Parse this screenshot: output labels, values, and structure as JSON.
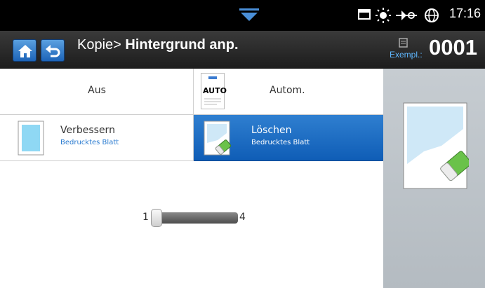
{
  "status_bar": {
    "time": "17:16",
    "icons": [
      "pull-down-arrow-icon",
      "window-icon",
      "brightness-icon",
      "network-icon",
      "globe-icon"
    ]
  },
  "header": {
    "title_prefix": "Kopie> ",
    "title_main": "Hintergrund anp.",
    "copies_label": "Exempl.:",
    "copies_value": "0001",
    "buttons": [
      "home-icon",
      "back-icon"
    ]
  },
  "options": [
    {
      "label": "Aus",
      "selected": false
    },
    {
      "label": "Autom.",
      "icon_text": "AUTO",
      "selected": false
    },
    {
      "label": "Verbessern",
      "sublabel": "Bedrucktes Blatt",
      "selected": false
    },
    {
      "label": "Löschen",
      "sublabel": "Bedrucktes Blatt",
      "selected": true
    }
  ],
  "slider": {
    "min": "1",
    "max": "4",
    "value": 1
  },
  "colors": {
    "selected_bg": "#1a6cc4",
    "sublabel_blue": "#2a7bd0",
    "copies_label": "#5fb7ff",
    "preview_bg": "#bec4ca"
  }
}
